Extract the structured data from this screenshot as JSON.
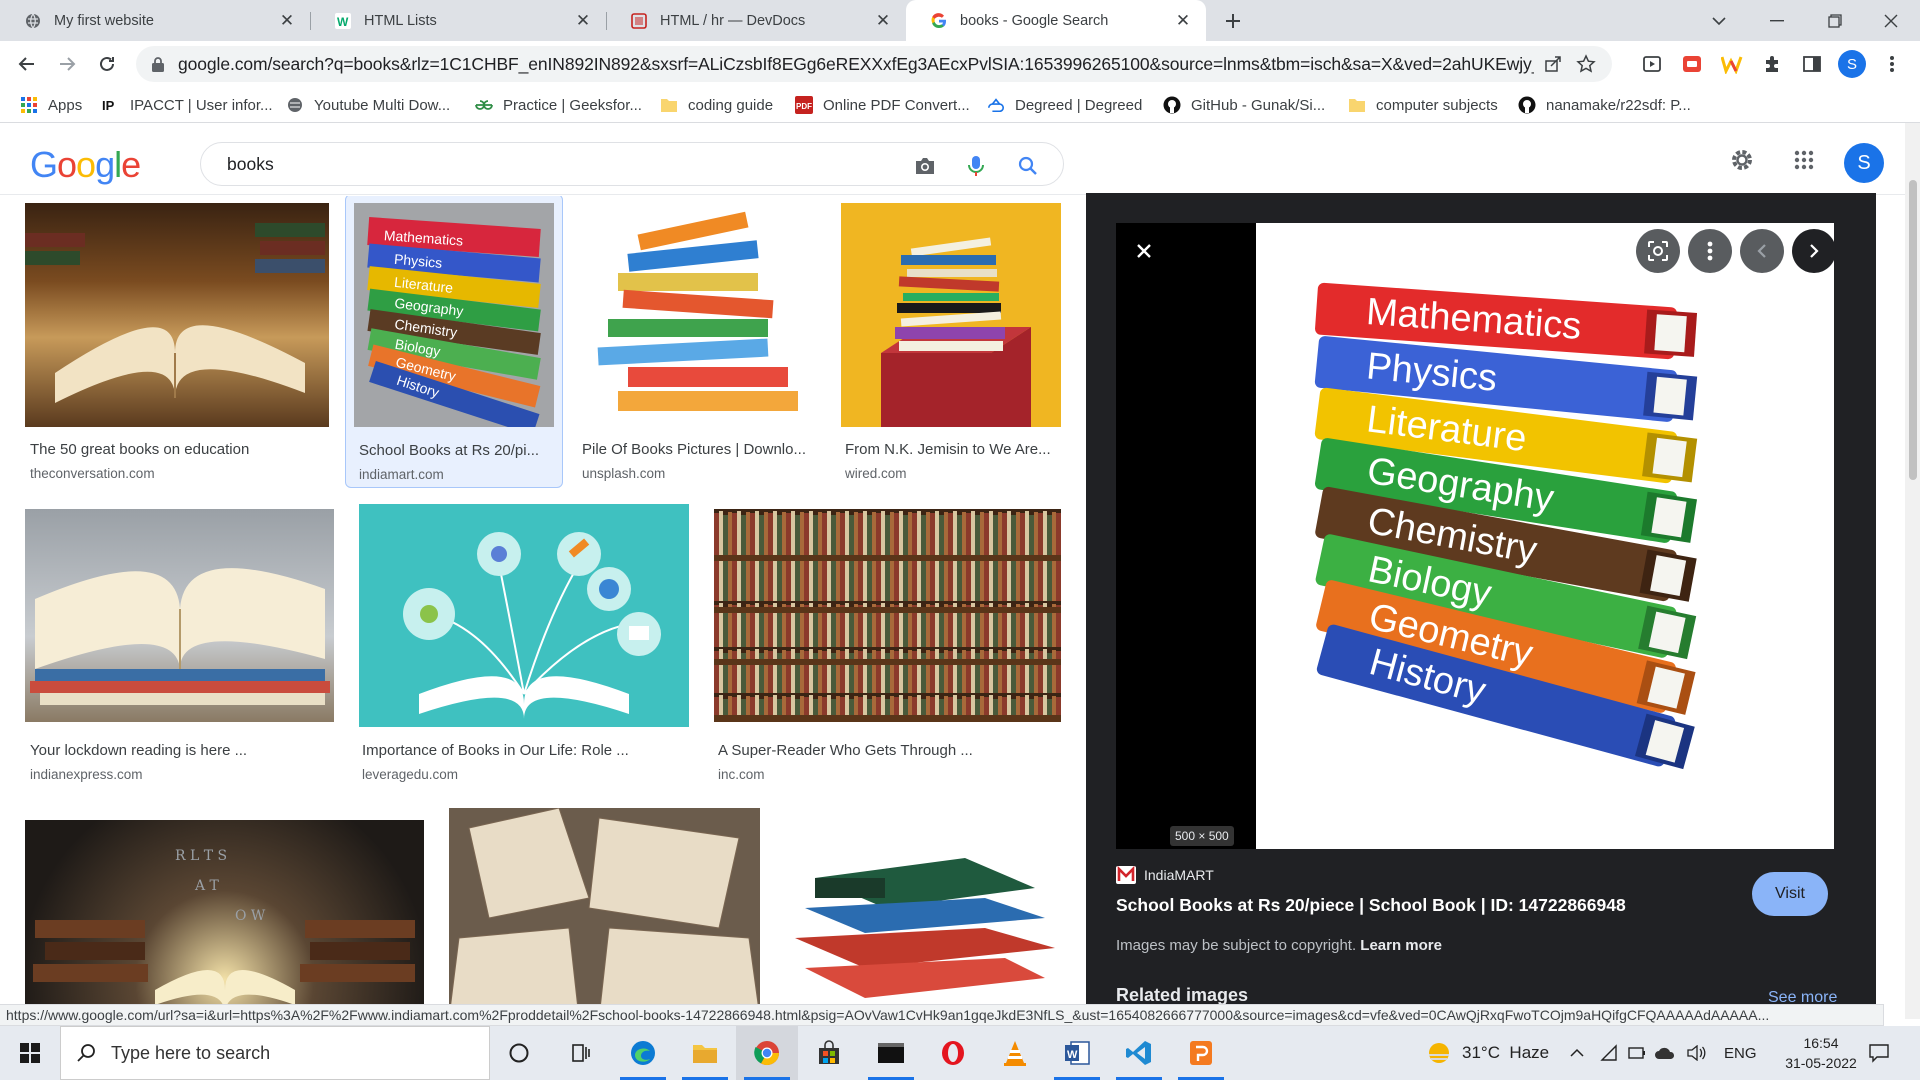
{
  "tabs": [
    {
      "title": "My first website"
    },
    {
      "title": "HTML Lists"
    },
    {
      "title": "HTML / hr — DevDocs"
    },
    {
      "title": "books - Google Search"
    }
  ],
  "address": {
    "url": "google.com/search?q=books&rlz=1C1CHBF_enIN892IN892&sxsrf=ALiCzsbIf8EGg6eREXXxfEg3AEcxPvlSIA:1653996265100&source=lnms&tbm=isch&sa=X&ved=2ahUKEwjy_t..."
  },
  "profile_initial": "S",
  "bookmarks": [
    {
      "label": "Apps"
    },
    {
      "label": "IPACCT | User infor..."
    },
    {
      "label": "Youtube Multi Dow..."
    },
    {
      "label": "Practice | Geeksfor..."
    },
    {
      "label": "coding guide"
    },
    {
      "label": "Online PDF Convert..."
    },
    {
      "label": "Degreed | Degreed"
    },
    {
      "label": "GitHub - Gunak/Si..."
    },
    {
      "label": "computer subjects"
    },
    {
      "label": "nanamake/r22sdf: P..."
    }
  ],
  "google": {
    "logo": "Google",
    "query": "books",
    "avatar_initial": "S"
  },
  "results": [
    {
      "caption": "The 50 great books on education",
      "source": "theconversation.com"
    },
    {
      "caption": "School Books at Rs 20/pi...",
      "source": "indiamart.com"
    },
    {
      "caption": "Pile Of Books Pictures | Downlo...",
      "source": "unsplash.com"
    },
    {
      "caption": "From N.K. Jemisin to We Are...",
      "source": "wired.com"
    },
    {
      "caption": "Your lockdown reading is here ...",
      "source": "indianexpress.com"
    },
    {
      "caption": "Importance of Books in Our Life: Role ...",
      "source": "leveragedu.com"
    },
    {
      "caption": "A Super-Reader Who Gets Through ...",
      "source": "inc.com"
    }
  ],
  "book_spines": [
    "Mathematics",
    "Physics",
    "Literature",
    "Geography",
    "Chemistry",
    "Biology",
    "Geometry",
    "History"
  ],
  "panel": {
    "dimensions": "500 × 500",
    "source_name": "IndiaMART",
    "title": "School Books at Rs 20/piece | School Book | ID: 14722866948",
    "visit_label": "Visit",
    "copyright_text": "Images may be subject to copyright.",
    "learn_more": "Learn more",
    "related_heading": "Related images",
    "see_more": "See more"
  },
  "status_url": "https://www.google.com/url?sa=i&url=https%3A%2F%2Fwww.indiamart.com%2Fproddetail%2Fschool-books-14722866948.html&psig=AOvVaw1CvHk9an1gqeJkdE3NfLS_&ust=1654082666777000&source=images&cd=vfe&ved=0CAwQjRxqFwoTCOjm9aHQifgCFQAAAAAdAAAAA...",
  "taskbar": {
    "search_placeholder": "Type here to search",
    "weather": "31°C  Haze",
    "language": "ENG",
    "time": "16:54",
    "date": "31-05-2022"
  },
  "colors": {
    "accent": "#1a73e8",
    "panel_bg": "#202124",
    "visit_button": "#8ab4f8"
  }
}
